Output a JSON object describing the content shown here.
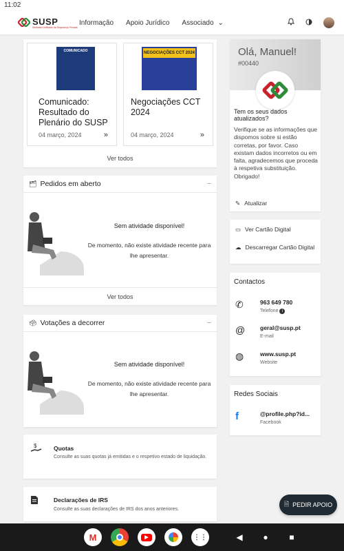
{
  "status_bar": {
    "time": "11:02"
  },
  "header": {
    "logo_name": "SUSP",
    "logo_sub": "Sindicato Unificado da Segurança Privada",
    "nav": [
      {
        "label": "Informação"
      },
      {
        "label": "Apoio Jurídico"
      },
      {
        "label": "Associado"
      }
    ]
  },
  "news": {
    "items": [
      {
        "title": "Comunicado: Resultado do Plenário do SUSP",
        "date": "04 março, 2024",
        "thumb_text": "COMUNICADO"
      },
      {
        "title": "Negociações CCT 2024",
        "date": "04 março, 2024",
        "thumb_text": "NEGOCIAÇÕES CCT 2024"
      }
    ],
    "see_all": "Ver todos"
  },
  "pedidos": {
    "title": "Pedidos em aberto",
    "empty_title": "Sem atividade disponível!",
    "empty_desc": "De momento, não existe atividade recente para lhe apresentar.",
    "see_all": "Ver todos"
  },
  "votacoes": {
    "title": "Votações a decorrer",
    "empty_title": "Sem atividade disponível!",
    "empty_desc": "De momento, não existe atividade recente para lhe apresentar."
  },
  "quotas": {
    "title": "Quotas",
    "desc": "Consulte as suas quotas já emitidas e o respetivo estado de liquidação."
  },
  "irs": {
    "title": "Declarações de IRS",
    "desc": "Consulte as suas declarações de IRS dos anos anteriores."
  },
  "profile": {
    "greeting": "Olá, Manuel!",
    "member_id": "#00440",
    "question": "Tem os seus dados atualizados?",
    "text": "Verifique se as informações que dispomos sobre si estão corretas, por favor. Caso existam dados incorretos ou em falta, agradecemos que proceda à respetiva substituição. Obrigado!",
    "update_label": "Atualizar"
  },
  "digital_card": {
    "view_label": "Ver Cartão Digital",
    "download_label": "Descarregar Cartão Digital"
  },
  "contacts": {
    "title": "Contactos",
    "items": [
      {
        "value": "963 649 780",
        "label": "Telefone",
        "icon": "phone-icon"
      },
      {
        "value": "geral@susp.pt",
        "label": "E-mail",
        "icon": "at-icon"
      },
      {
        "value": "www.susp.pt",
        "label": "Website",
        "icon": "globe-icon"
      }
    ]
  },
  "social": {
    "title": "Redes Sociais",
    "items": [
      {
        "value": "@profile.php?id...",
        "label": "Facebook",
        "icon": "facebook-icon"
      }
    ]
  },
  "fab": {
    "label": "PEDIR APOIO"
  },
  "colors": {
    "brand_red": "#c8232c",
    "brand_green": "#2e8b3a",
    "fab_bg": "#1f2a33"
  }
}
